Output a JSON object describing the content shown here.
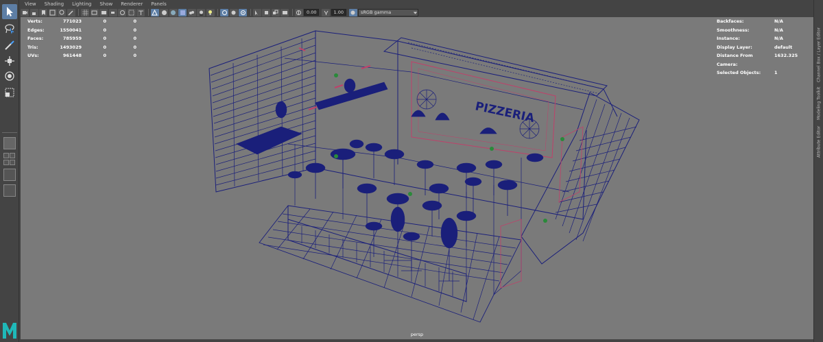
{
  "menu": [
    "View",
    "Shading",
    "Lighting",
    "Show",
    "Renderer",
    "Panels"
  ],
  "toolbar": {
    "exposure_value": "0.00",
    "gamma_value": "1.00",
    "colorspace": "sRGB gamma"
  },
  "hud_left": [
    {
      "label": "Verts:",
      "v1": "771023",
      "v2": "0",
      "v3": "0"
    },
    {
      "label": "Edges:",
      "v1": "1550041",
      "v2": "0",
      "v3": "0"
    },
    {
      "label": "Faces:",
      "v1": "785959",
      "v2": "0",
      "v3": "0"
    },
    {
      "label": "Tris:",
      "v1": "1493029",
      "v2": "0",
      "v3": "0"
    },
    {
      "label": "UVs:",
      "v1": "961448",
      "v2": "0",
      "v3": "0"
    }
  ],
  "hud_right": [
    {
      "label": "Backfaces:",
      "value": "N/A"
    },
    {
      "label": "Smoothness:",
      "value": "N/A"
    },
    {
      "label": "Instance:",
      "value": "N/A"
    },
    {
      "label": "Display Layer:",
      "value": "default"
    },
    {
      "label": "Distance From Camera:",
      "value": "1632.325"
    },
    {
      "label": "Selected Objects:",
      "value": "1"
    }
  ],
  "scene_sign": "PIZZERIA",
  "camera": "persp",
  "side_tabs": [
    "Channel Box / Layer Editor",
    "Modeling Toolkit",
    "Attribute Editor"
  ],
  "colors": {
    "wire": "#1a1f7a",
    "pink": "#c0406a",
    "viewport_bg": "#7a7a7a",
    "accent": "#5d7ea5",
    "logo": "#1fb8b8"
  }
}
